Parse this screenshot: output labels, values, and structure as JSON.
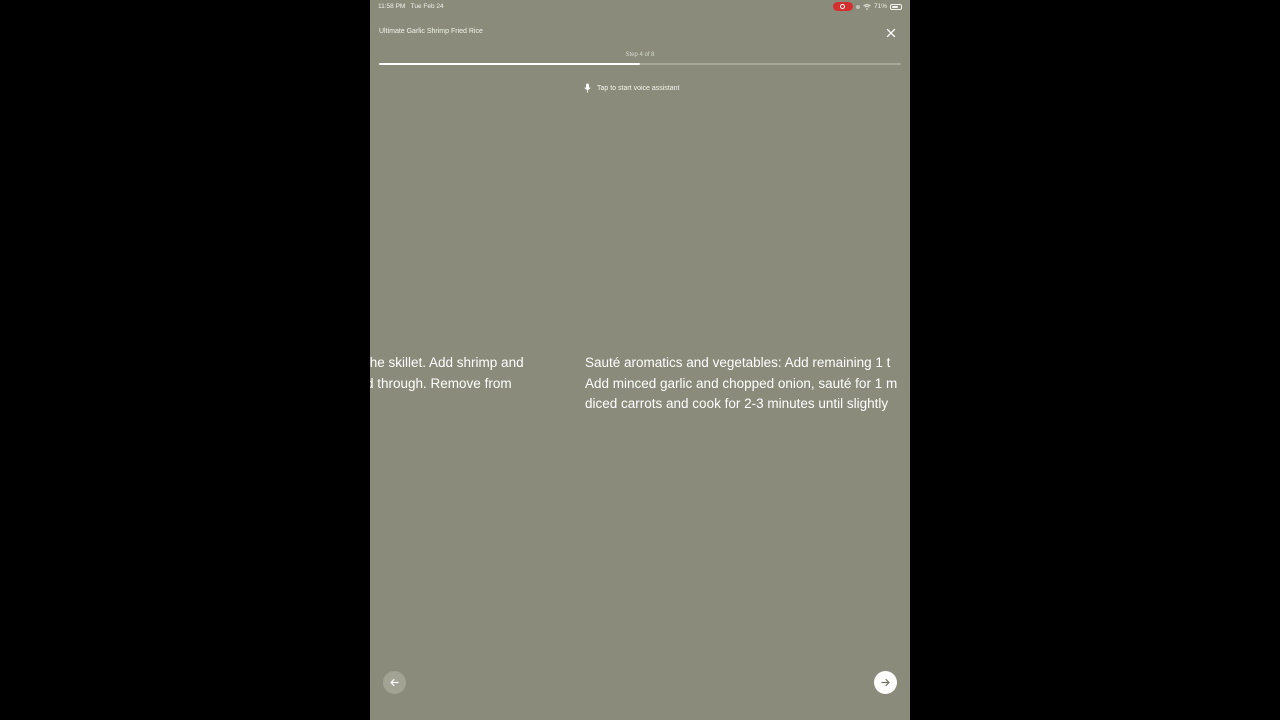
{
  "status_bar": {
    "time": "11:58 PM",
    "date": "Tue Feb 24",
    "battery": "71%"
  },
  "header": {
    "title": "Ultimate Garlic Shrimp Fried Rice"
  },
  "progress": {
    "label": "Step 4 of 8",
    "fraction": 0.5
  },
  "voice_assistant": {
    "label": "Tap to start voice assistant"
  },
  "steps": {
    "previous": {
      "lines": [
        "the skillet. Add shrimp and",
        "d through. Remove from"
      ]
    },
    "current": {
      "lines": [
        "Sauté aromatics and vegetables: Add remaining 1 t",
        "Add minced garlic and chopped onion, sauté for 1 m",
        "diced carrots and cook for 2-3 minutes until slightly"
      ]
    }
  },
  "icons": {
    "close": "close-icon",
    "mic": "microphone-icon",
    "prev": "arrow-left-icon",
    "next": "arrow-right-icon"
  },
  "colors": {
    "background": "#8a8b7b",
    "accent": "#ffffff",
    "record": "#d32f2f"
  }
}
